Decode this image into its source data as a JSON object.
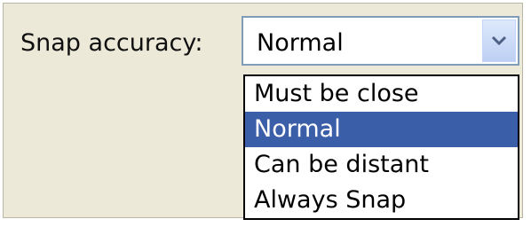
{
  "snap_accuracy": {
    "label": "Snap accuracy:",
    "selected_value": "Normal",
    "button_icon": "chevron-down-icon",
    "options": [
      {
        "label": "Must be close",
        "selected": false
      },
      {
        "label": "Normal",
        "selected": true
      },
      {
        "label": "Can be distant",
        "selected": false
      },
      {
        "label": "Always Snap",
        "selected": false
      }
    ]
  },
  "colors": {
    "selection_highlight": "#3a5ea8",
    "panel_background": "#ece9d8",
    "combo_border": "#7f9db9"
  }
}
